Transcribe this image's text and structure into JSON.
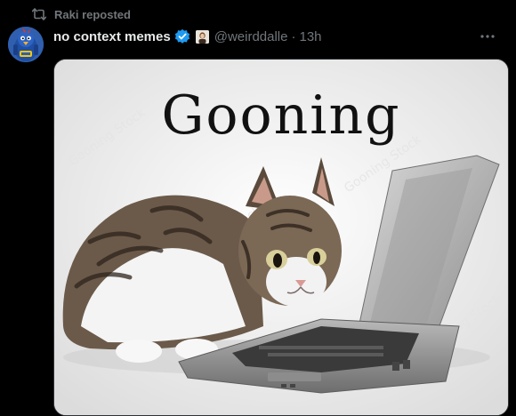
{
  "repost": {
    "label": "Raki reposted",
    "icon": "repost-icon"
  },
  "author": {
    "display_name": "no context memes",
    "handle": "@weirddalle",
    "separator": "·",
    "time": "13h",
    "verified": true,
    "avatar_icon": "bird-avatar"
  },
  "media": {
    "caption": "Gooning",
    "watermark": "Gooning Stock",
    "subject": "cat-with-laptop"
  },
  "colors": {
    "background": "#000000",
    "text": "#e7e9ea",
    "muted": "#71767b",
    "verified": "#1d9bf0"
  }
}
